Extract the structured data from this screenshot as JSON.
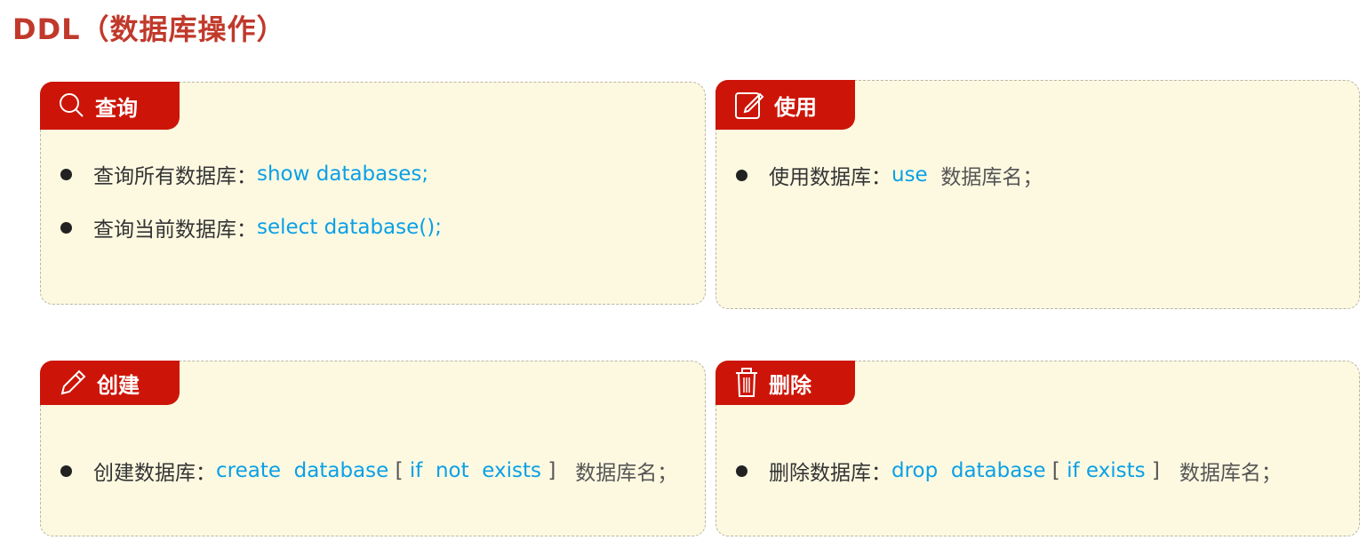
{
  "title": "DDL（数据库操作）",
  "colors": {
    "accent": "#cc1508",
    "code": "#0aa0e6",
    "card_bg": "#fdf9e1"
  },
  "cards": {
    "query": {
      "label": "查询",
      "icon": "search-icon",
      "items": [
        {
          "label": "查询所有数据库：",
          "code": "show databases;"
        },
        {
          "label": "查询当前数据库：",
          "code": "select database();"
        }
      ]
    },
    "use": {
      "label": "使用",
      "icon": "edit-icon",
      "items": [
        {
          "label": "使用数据库：",
          "code": "use",
          "rest": "  数据库名；"
        }
      ]
    },
    "create": {
      "label": "创建",
      "icon": "pencil-icon",
      "items": [
        {
          "label": "创建数据库：",
          "code": "create  database",
          "b1": " [ ",
          "opt": "if  not  exists",
          "b2": " ]  ",
          "rest": " 数据库名；"
        }
      ]
    },
    "drop": {
      "label": "删除",
      "icon": "trash-icon",
      "items": [
        {
          "label": "删除数据库：",
          "code": "drop  database",
          "b1": " [ ",
          "opt": "if exists",
          "b2": " ]  ",
          "rest": " 数据库名；"
        }
      ]
    }
  }
}
